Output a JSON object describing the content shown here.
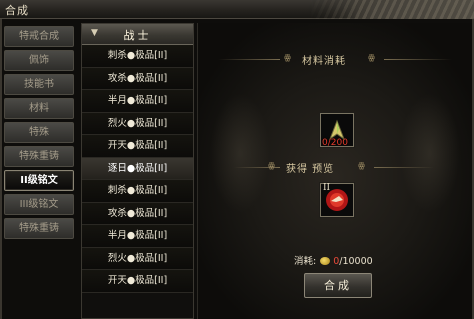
{
  "window": {
    "title": "合成"
  },
  "categories": [
    {
      "label": "特戒合成"
    },
    {
      "label": "佩饰"
    },
    {
      "label": "技能书"
    },
    {
      "label": "材料"
    },
    {
      "label": "特殊"
    },
    {
      "label": "特殊重铸"
    },
    {
      "label": "II级铭文"
    },
    {
      "label": "III级铭文"
    },
    {
      "label": "特殊重铸"
    }
  ],
  "sub_list": {
    "header": "战士",
    "items": [
      "刺杀●极品[II]",
      "攻杀●极品[II]",
      "半月●极品[II]",
      "烈火●极品[II]",
      "开天●极品[II]",
      "逐日●极品[II]",
      "刺杀●极品[II]",
      "攻杀●极品[II]",
      "半月●极品[II]",
      "烈火●极品[II]",
      "开天●极品[II]"
    ]
  },
  "panel": {
    "materials_title": "材料消耗",
    "ornament_left": "ꙮ",
    "ornament_right": "ꙮ",
    "material_count": "0/200",
    "preview_title": "获得 预览",
    "result_grade": "II",
    "cost_label": "消耗:",
    "cost_have": "0",
    "cost_need": "/10000",
    "compose_button": "合成"
  },
  "colors": {
    "accent": "#e23a2a",
    "gold": "#d8c9a2"
  }
}
